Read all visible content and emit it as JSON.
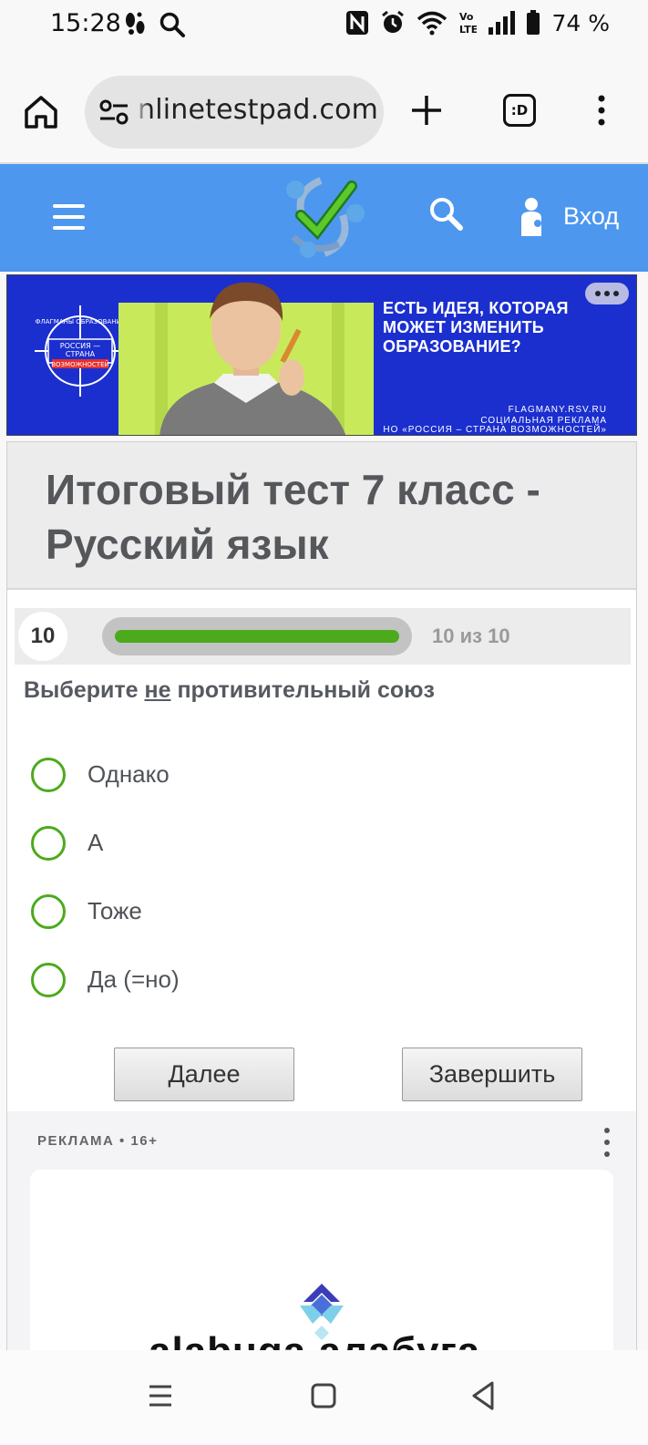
{
  "status_bar": {
    "time": "15:28",
    "battery_percent": "74 %",
    "icons": [
      "footsteps-icon",
      "search-icon",
      "nfc-icon",
      "alarm-icon",
      "wifi-icon",
      "volte-icon",
      "signal-icon",
      "battery-icon"
    ]
  },
  "browser": {
    "url": "nlinetestpad.com",
    "tabs_label": ":D"
  },
  "header": {
    "login_label": "Вход",
    "accent_color": "#4d97ef"
  },
  "banner": {
    "headline": "ЕСТЬ ИДЕЯ, КОТОРАЯ МОЖЕТ ИЗМЕНИТЬ ОБРАЗОВАНИЕ?",
    "site": "FLAGMANY.RSV.RU",
    "social": "СОЦИАЛЬНАЯ РЕКЛАМА",
    "org": "НО «РОССИЯ – СТРАНА ВОЗМОЖНОСТЕЙ»",
    "logo_top": "ФЛАГМАНЫ ОБРАЗОВАНИЯ",
    "logo_line1": "РОССИЯ —",
    "logo_line2": "СТРАНА",
    "logo_line3": "ВОЗМОЖНОСТЕЙ"
  },
  "test": {
    "title": "Итоговый тест 7 класс - Русский язык",
    "question_number": "10",
    "progress_text": "10 из 10",
    "progress_fraction": 1.0,
    "question_pre": "Выберите ",
    "question_underlined": "не",
    "question_post": " противительный союз",
    "options": [
      "Однако",
      "А",
      "Тоже",
      "Да (=но)"
    ],
    "next_button": "Далее",
    "finish_button": "Завершить",
    "accent_color": "#4caa1c"
  },
  "ad": {
    "label": "РЕКЛАМА • 16+",
    "brand": "alabuga  алабуга"
  }
}
